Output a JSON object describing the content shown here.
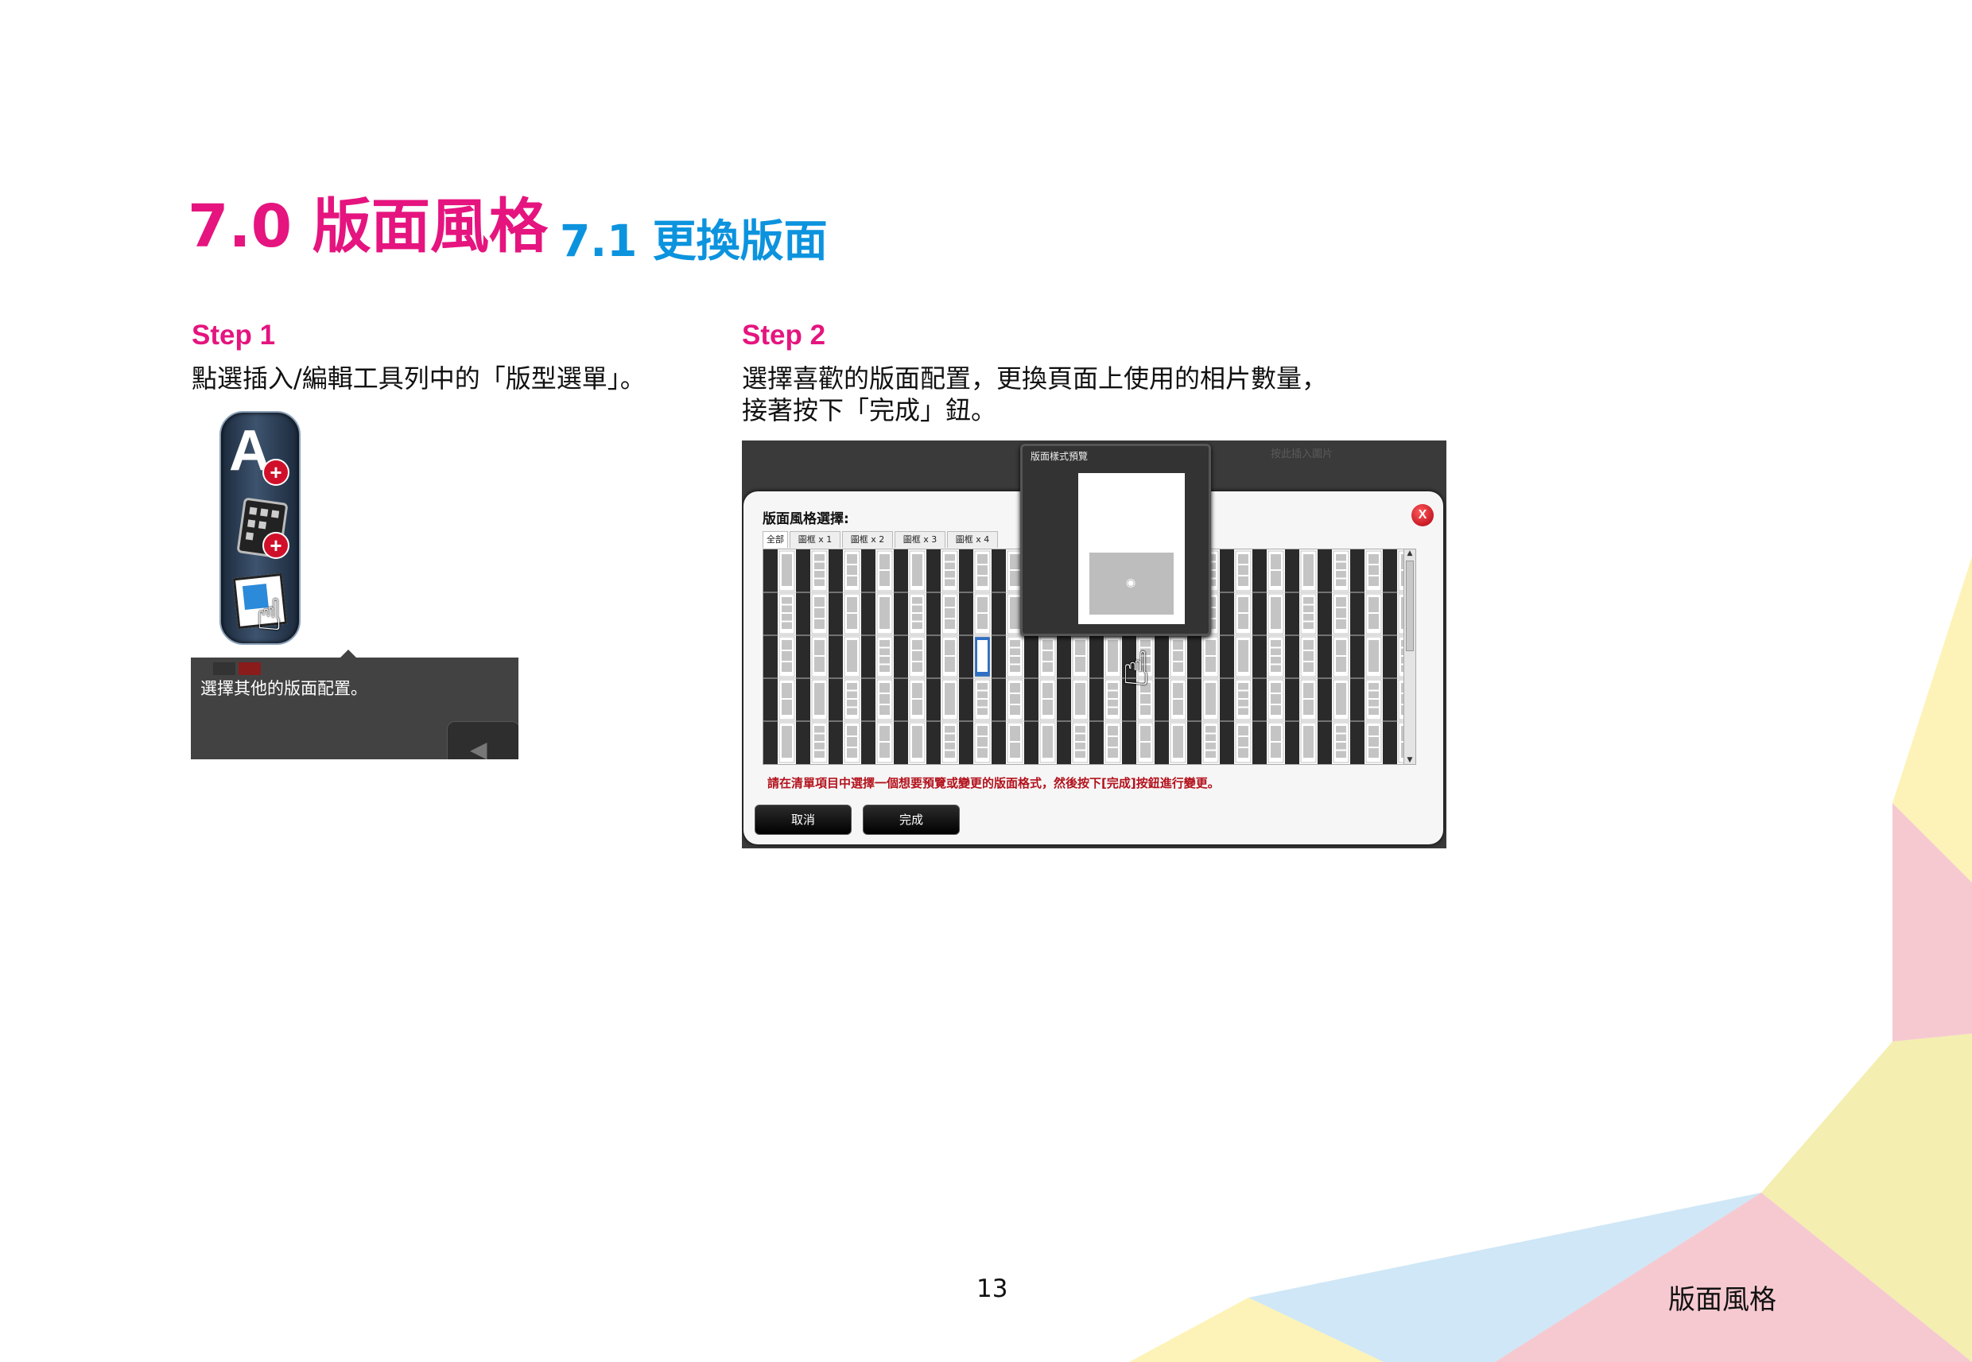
{
  "heading": {
    "main": "7.0 版面風格",
    "sub": "7.1 更換版面"
  },
  "step1": {
    "label": "Step 1",
    "text": "點選插入/編輯工具列中的「版型選單」。",
    "screenshot": {
      "tooltip_text": "選擇其他的版面配置。"
    }
  },
  "step2": {
    "label": "Step 2",
    "text_line1": "選擇喜歡的版面配置，更換頁面上使用的相片數量，",
    "text_line2": "接著按下「完成」鈕。",
    "screenshot": {
      "top_label": "按此插入圖片",
      "preview_title": "版面樣式預覽",
      "dialog_title": "版面風格選擇:",
      "tabs": [
        "全部",
        "圖框 x 1",
        "圖框 x 2",
        "圖框 x 3",
        "圖框 x 4"
      ],
      "instruction": "請在清單項目中選擇一個想要預覽或變更的版面格式，然後按下[完成]按鈕進行變更。",
      "cancel_label": "取消",
      "done_label": "完成",
      "close_symbol": "X"
    }
  },
  "footer": {
    "page_number": "13",
    "section": "版面風格"
  },
  "colors": {
    "heading_magenta": "#e5147f",
    "heading_blue": "#0c93de",
    "instruction_red": "#b3121c",
    "selected_blue": "#2f6fc4"
  }
}
